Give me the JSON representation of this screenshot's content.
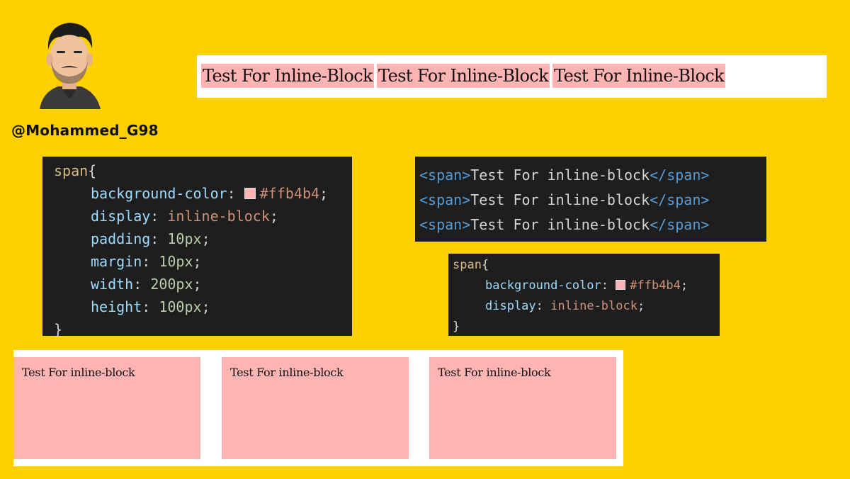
{
  "author": {
    "handle": "@Mohammed_G98"
  },
  "inline_preview": {
    "items": [
      "Test For Inline-Block",
      "Test For Inline-Block",
      "Test For Inline-Block"
    ],
    "background": "#ffb4b4"
  },
  "css_block": {
    "selector": "span",
    "open": "{",
    "close": "}",
    "rules": [
      {
        "prop": "background-color",
        "value": "#ffb4b4",
        "swatch": true
      },
      {
        "prop": "display",
        "value": "inline-block"
      },
      {
        "prop": "padding",
        "value": "10px"
      },
      {
        "prop": "margin",
        "value": "10px"
      },
      {
        "prop": "width",
        "value": "200px"
      },
      {
        "prop": "height",
        "value": "100px"
      }
    ]
  },
  "html_code": {
    "open_tag": "<span>",
    "close_tag": "</span>",
    "text": "Test For inline-block"
  },
  "css_inline": {
    "selector": "span",
    "open": "{",
    "close": "}",
    "rules": [
      {
        "prop": "background-color",
        "value": "#ffb4b4",
        "swatch": true
      },
      {
        "prop": "display",
        "value": "inline-block"
      }
    ]
  },
  "block_preview": {
    "items": [
      "Test For inline-block",
      "Test For inline-block",
      "Test For inline-block"
    ]
  },
  "colors": {
    "page_background": "#ffd000",
    "span_background": "#ffb4b4",
    "code_background": "#1e1e1e"
  }
}
